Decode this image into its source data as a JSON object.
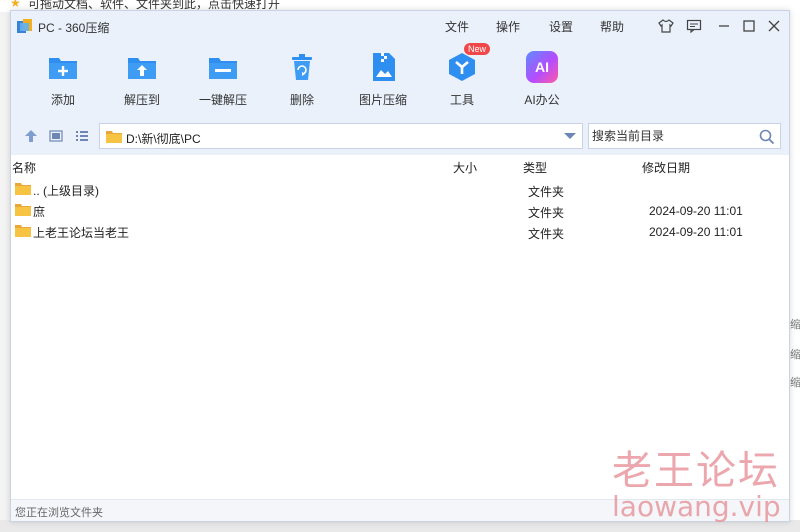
{
  "background": {
    "top_text": "可拖动文档、软件、文件夹到此，点击快速打开",
    "right_fragments": [
      "缩",
      "缩",
      "缩"
    ]
  },
  "window": {
    "title": "PC - 360压缩",
    "menu": [
      "文件",
      "操作",
      "设置",
      "帮助"
    ],
    "title_buttons": [
      "shirt-icon",
      "feedback-icon",
      "minimize-icon",
      "maximize-icon",
      "close-icon"
    ]
  },
  "toolbar": {
    "items": [
      {
        "label": "添加",
        "icon": "add-archive-icon"
      },
      {
        "label": "解压到",
        "icon": "extract-to-icon"
      },
      {
        "label": "一键解压",
        "icon": "one-click-extract-icon"
      },
      {
        "label": "删除",
        "icon": "delete-icon"
      },
      {
        "label": "图片压缩",
        "icon": "image-compress-icon"
      },
      {
        "label": "工具",
        "icon": "tools-icon",
        "badge": "New"
      },
      {
        "label": "AI办公",
        "icon": "ai-office-icon",
        "icon_text": "AI"
      }
    ]
  },
  "addressbar": {
    "path": "D:\\新\\彻底\\PC",
    "search_placeholder": "搜索当前目录"
  },
  "columns": {
    "name": "名称",
    "size": "大小",
    "type": "类型",
    "modified": "修改日期"
  },
  "files": [
    {
      "name": ".. (上级目录)",
      "type": "文件夹",
      "date": ""
    },
    {
      "name": "庶",
      "type": "文件夹",
      "date": "2024-09-20 11:01"
    },
    {
      "name": "上老王论坛当老王",
      "type": "文件夹",
      "date": "2024-09-20 11:01"
    }
  ],
  "status": "您正在浏览文件夹",
  "watermark": {
    "cn": "老王论坛",
    "en": "laowang.vip"
  },
  "colors": {
    "accent": "#2f8ff0",
    "toolbar_bg": "#eaf1fb",
    "folder": "#f6c342",
    "badge": "#f04848",
    "watermark": "#e58a92"
  }
}
